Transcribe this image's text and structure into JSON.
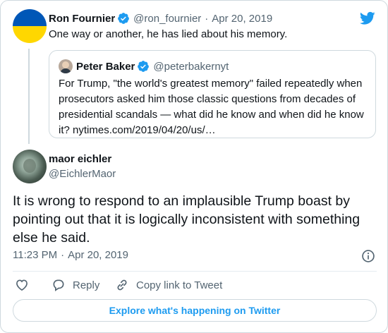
{
  "parent_tweet": {
    "name": "Ron Fournier",
    "handle": "@ron_fournier",
    "separator": "·",
    "date": "Apr 20, 2019",
    "text": "One way or another, he has lied about his memory."
  },
  "quoted_tweet": {
    "name": "Peter Baker",
    "handle": "@peterbakernyt",
    "lines": [
      "For Trump, \"the world's greatest memory\" failed repeatedly when",
      "prosecutors asked him those classic questions from decades of",
      "presidential scandals — what did he know and when did he know",
      "it? nytimes.com/2019/04/20/us/…"
    ]
  },
  "main_tweet": {
    "name": "maor eichler",
    "handle": "@EichlerMaor",
    "lines": [
      "It is wrong to respond to an implausible Trump boast by",
      "pointing out that it is logically inconsistent with something",
      "else he said."
    ],
    "time": "11:23 PM",
    "separator": "·",
    "date": "Apr 20, 2019"
  },
  "actions": {
    "reply_label": "Reply",
    "copy_link_label": "Copy link to Tweet"
  },
  "explore_label": "Explore what's happening on Twitter",
  "icons": {
    "brand": "twitter-bird-icon",
    "verified": "verified-badge-icon",
    "info": "info-icon",
    "like": "heart-icon",
    "reply": "reply-bubble-icon",
    "link": "link-icon"
  },
  "colors": {
    "accent": "#1d9bf0",
    "text": "#0f1419",
    "muted": "#536471",
    "border": "#cfd9de",
    "ukraine_blue": "#0057b7",
    "ukraine_yellow": "#ffd700"
  }
}
